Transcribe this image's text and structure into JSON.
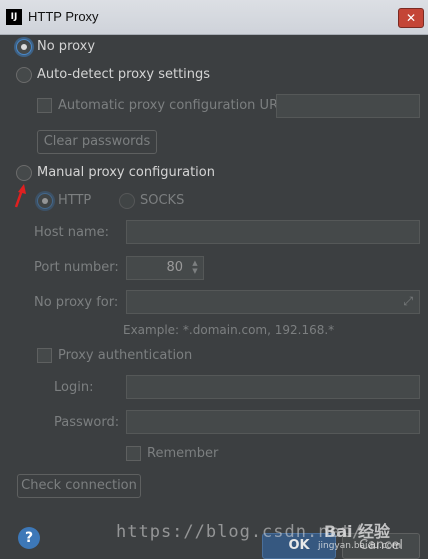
{
  "window": {
    "title": "HTTP Proxy",
    "close_label": "✕",
    "app_icon_text": "IJ"
  },
  "proxy_mode": {
    "no_proxy": "No proxy",
    "auto_detect": "Auto-detect proxy settings",
    "manual": "Manual proxy configuration",
    "selected": "no_proxy"
  },
  "auto": {
    "pac_url_label": "Automatic proxy configuration URL:",
    "pac_url_value": "",
    "clear_passwords": "Clear passwords"
  },
  "manual": {
    "type_http": "HTTP",
    "type_socks": "SOCKS",
    "host_label": "Host name:",
    "host_value": "",
    "port_label": "Port number:",
    "port_value": "80",
    "no_proxy_label": "No proxy for:",
    "no_proxy_value": "",
    "example": "Example: *.domain.com, 192.168.*",
    "proxy_auth": "Proxy authentication",
    "login_label": "Login:",
    "login_value": "",
    "password_label": "Password:",
    "password_value": "",
    "remember": "Remember"
  },
  "footer": {
    "check_connection": "Check connection",
    "help": "?",
    "ok": "OK",
    "cancel": "Cancel"
  },
  "watermark": {
    "url_text": "https://blog.csdn.net/",
    "logo_text": "Bai 经验",
    "site_text": "jingyan.baidu.com"
  },
  "colors": {
    "background": "#3c3f41",
    "accent": "#4a88c7",
    "annotation_arrow": "#e02020"
  }
}
